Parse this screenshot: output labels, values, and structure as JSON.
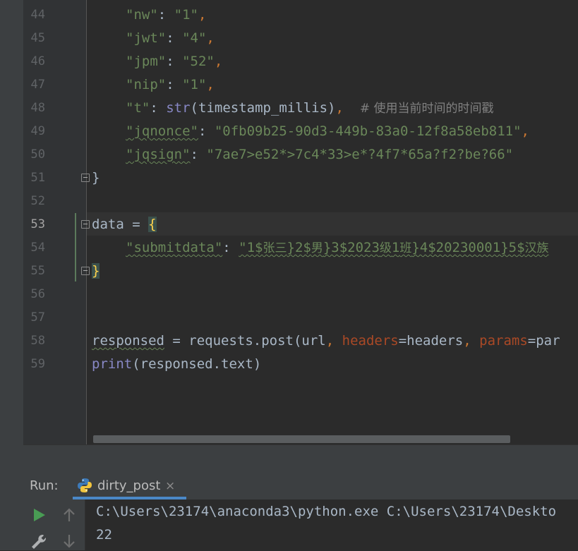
{
  "editor": {
    "lines": [
      {
        "n": "44",
        "key": "\"nw\"",
        "val": "\"1\""
      },
      {
        "n": "45",
        "key": "\"jwt\"",
        "val": "\"4\""
      },
      {
        "n": "46",
        "key": "\"jpm\"",
        "val": "\"52\""
      },
      {
        "n": "47",
        "key": "\"nip\"",
        "val": "\"1\""
      },
      {
        "n": "48",
        "key": "\"t\"",
        "func": "str",
        "arg": "timestamp_millis",
        "comment": "# 使用当前时间的时间戳"
      },
      {
        "n": "49",
        "key": "\"jqnonce\"",
        "val": "\"0fb09b25-90d3-449b-83a0-12f8a58eb811\""
      },
      {
        "n": "50",
        "key": "\"jqsign\"",
        "val": "\"7ae7>e52*>7c4*33>e*?4f7*65a?f2?be?66\""
      },
      {
        "n": "51",
        "text": "}"
      },
      {
        "n": "52",
        "text": ""
      },
      {
        "n": "53",
        "var": "data",
        "op": " = ",
        "brace": "{"
      },
      {
        "n": "54",
        "key": "\"submitdata\"",
        "val_parts": [
          "\"1$",
          "张三",
          "}2$",
          "男",
          "}3$2023",
          "级",
          "1",
          "班",
          "}4$20230001}5$",
          "汉族"
        ]
      },
      {
        "n": "55",
        "brace": "}"
      },
      {
        "n": "56",
        "text": ""
      },
      {
        "n": "57",
        "text": ""
      },
      {
        "n": "58",
        "var": "responsed",
        "op": " = ",
        "call": "requests.post(url",
        "kw1": "headers",
        "kv1": "headers",
        "kw2": "params",
        "kv2": "par"
      },
      {
        "n": "59",
        "func": "print",
        "arg": "responsed.text"
      }
    ]
  },
  "run": {
    "label": "Run:",
    "tab": "dirty_post",
    "close": "×",
    "console": [
      "C:\\Users\\23174\\anaconda3\\python.exe C:\\Users\\23174\\Deskto",
      "22"
    ]
  }
}
